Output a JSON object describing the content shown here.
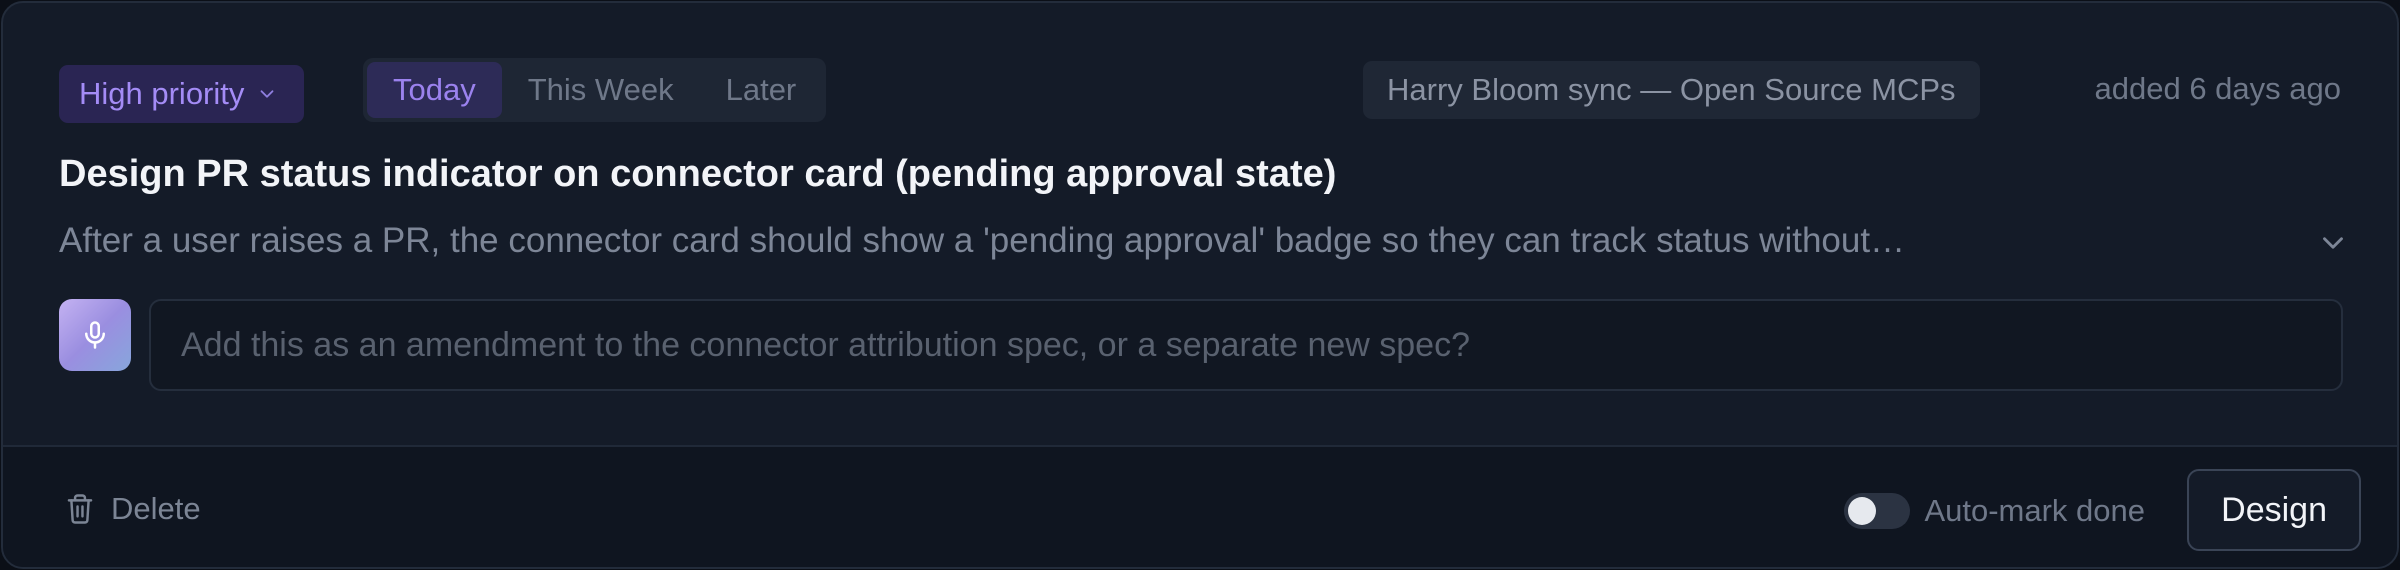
{
  "priority": {
    "label": "High priority",
    "icon": "chevron-down-icon",
    "color": "#a48cf6"
  },
  "timeframe": {
    "options": [
      "Today",
      "This Week",
      "Later"
    ],
    "selected": "Today"
  },
  "source": {
    "label": "Harry Bloom sync — Open Source MCPs"
  },
  "added": "added 6 days ago",
  "task": {
    "title": "Design PR status indicator on connector card (pending approval state)",
    "description": "After a user raises a PR, the connector card should show a 'pending approval' badge so they can track status without…"
  },
  "note": {
    "value": "",
    "placeholder": "Add this as an amendment to the connector attribution spec, or a separate new spec?",
    "mic_icon": "microphone-icon"
  },
  "footer": {
    "delete_label": "Delete",
    "delete_icon": "trash-icon",
    "auto_mark_label": "Auto-mark done",
    "auto_mark_on": false,
    "design_label": "Design"
  }
}
